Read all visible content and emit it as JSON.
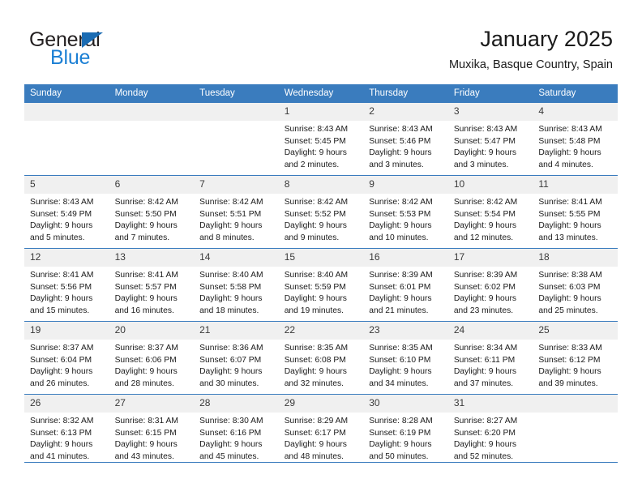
{
  "brand": {
    "logo_text_primary": "General",
    "logo_text_secondary": "Blue",
    "logo_triangle_color": "#1b6cb3",
    "logo_secondary_color": "#1b7fd4"
  },
  "header": {
    "title": "January 2025",
    "subtitle": "Muxika, Basque Country, Spain"
  },
  "theme": {
    "header_row_bg": "#3a7cbe",
    "daynum_bg": "#f0f0f0",
    "grid_line": "#3a7cbe",
    "text": "#1a1a1a"
  },
  "calendar": {
    "weekday_headers": [
      "Sunday",
      "Monday",
      "Tuesday",
      "Wednesday",
      "Thursday",
      "Friday",
      "Saturday"
    ],
    "weeks": [
      [
        {
          "day": "",
          "lines": []
        },
        {
          "day": "",
          "lines": []
        },
        {
          "day": "",
          "lines": []
        },
        {
          "day": "1",
          "lines": [
            "Sunrise: 8:43 AM",
            "Sunset: 5:45 PM",
            "Daylight: 9 hours",
            "and 2 minutes."
          ]
        },
        {
          "day": "2",
          "lines": [
            "Sunrise: 8:43 AM",
            "Sunset: 5:46 PM",
            "Daylight: 9 hours",
            "and 3 minutes."
          ]
        },
        {
          "day": "3",
          "lines": [
            "Sunrise: 8:43 AM",
            "Sunset: 5:47 PM",
            "Daylight: 9 hours",
            "and 3 minutes."
          ]
        },
        {
          "day": "4",
          "lines": [
            "Sunrise: 8:43 AM",
            "Sunset: 5:48 PM",
            "Daylight: 9 hours",
            "and 4 minutes."
          ]
        }
      ],
      [
        {
          "day": "5",
          "lines": [
            "Sunrise: 8:43 AM",
            "Sunset: 5:49 PM",
            "Daylight: 9 hours",
            "and 5 minutes."
          ]
        },
        {
          "day": "6",
          "lines": [
            "Sunrise: 8:42 AM",
            "Sunset: 5:50 PM",
            "Daylight: 9 hours",
            "and 7 minutes."
          ]
        },
        {
          "day": "7",
          "lines": [
            "Sunrise: 8:42 AM",
            "Sunset: 5:51 PM",
            "Daylight: 9 hours",
            "and 8 minutes."
          ]
        },
        {
          "day": "8",
          "lines": [
            "Sunrise: 8:42 AM",
            "Sunset: 5:52 PM",
            "Daylight: 9 hours",
            "and 9 minutes."
          ]
        },
        {
          "day": "9",
          "lines": [
            "Sunrise: 8:42 AM",
            "Sunset: 5:53 PM",
            "Daylight: 9 hours",
            "and 10 minutes."
          ]
        },
        {
          "day": "10",
          "lines": [
            "Sunrise: 8:42 AM",
            "Sunset: 5:54 PM",
            "Daylight: 9 hours",
            "and 12 minutes."
          ]
        },
        {
          "day": "11",
          "lines": [
            "Sunrise: 8:41 AM",
            "Sunset: 5:55 PM",
            "Daylight: 9 hours",
            "and 13 minutes."
          ]
        }
      ],
      [
        {
          "day": "12",
          "lines": [
            "Sunrise: 8:41 AM",
            "Sunset: 5:56 PM",
            "Daylight: 9 hours",
            "and 15 minutes."
          ]
        },
        {
          "day": "13",
          "lines": [
            "Sunrise: 8:41 AM",
            "Sunset: 5:57 PM",
            "Daylight: 9 hours",
            "and 16 minutes."
          ]
        },
        {
          "day": "14",
          "lines": [
            "Sunrise: 8:40 AM",
            "Sunset: 5:58 PM",
            "Daylight: 9 hours",
            "and 18 minutes."
          ]
        },
        {
          "day": "15",
          "lines": [
            "Sunrise: 8:40 AM",
            "Sunset: 5:59 PM",
            "Daylight: 9 hours",
            "and 19 minutes."
          ]
        },
        {
          "day": "16",
          "lines": [
            "Sunrise: 8:39 AM",
            "Sunset: 6:01 PM",
            "Daylight: 9 hours",
            "and 21 minutes."
          ]
        },
        {
          "day": "17",
          "lines": [
            "Sunrise: 8:39 AM",
            "Sunset: 6:02 PM",
            "Daylight: 9 hours",
            "and 23 minutes."
          ]
        },
        {
          "day": "18",
          "lines": [
            "Sunrise: 8:38 AM",
            "Sunset: 6:03 PM",
            "Daylight: 9 hours",
            "and 25 minutes."
          ]
        }
      ],
      [
        {
          "day": "19",
          "lines": [
            "Sunrise: 8:37 AM",
            "Sunset: 6:04 PM",
            "Daylight: 9 hours",
            "and 26 minutes."
          ]
        },
        {
          "day": "20",
          "lines": [
            "Sunrise: 8:37 AM",
            "Sunset: 6:06 PM",
            "Daylight: 9 hours",
            "and 28 minutes."
          ]
        },
        {
          "day": "21",
          "lines": [
            "Sunrise: 8:36 AM",
            "Sunset: 6:07 PM",
            "Daylight: 9 hours",
            "and 30 minutes."
          ]
        },
        {
          "day": "22",
          "lines": [
            "Sunrise: 8:35 AM",
            "Sunset: 6:08 PM",
            "Daylight: 9 hours",
            "and 32 minutes."
          ]
        },
        {
          "day": "23",
          "lines": [
            "Sunrise: 8:35 AM",
            "Sunset: 6:10 PM",
            "Daylight: 9 hours",
            "and 34 minutes."
          ]
        },
        {
          "day": "24",
          "lines": [
            "Sunrise: 8:34 AM",
            "Sunset: 6:11 PM",
            "Daylight: 9 hours",
            "and 37 minutes."
          ]
        },
        {
          "day": "25",
          "lines": [
            "Sunrise: 8:33 AM",
            "Sunset: 6:12 PM",
            "Daylight: 9 hours",
            "and 39 minutes."
          ]
        }
      ],
      [
        {
          "day": "26",
          "lines": [
            "Sunrise: 8:32 AM",
            "Sunset: 6:13 PM",
            "Daylight: 9 hours",
            "and 41 minutes."
          ]
        },
        {
          "day": "27",
          "lines": [
            "Sunrise: 8:31 AM",
            "Sunset: 6:15 PM",
            "Daylight: 9 hours",
            "and 43 minutes."
          ]
        },
        {
          "day": "28",
          "lines": [
            "Sunrise: 8:30 AM",
            "Sunset: 6:16 PM",
            "Daylight: 9 hours",
            "and 45 minutes."
          ]
        },
        {
          "day": "29",
          "lines": [
            "Sunrise: 8:29 AM",
            "Sunset: 6:17 PM",
            "Daylight: 9 hours",
            "and 48 minutes."
          ]
        },
        {
          "day": "30",
          "lines": [
            "Sunrise: 8:28 AM",
            "Sunset: 6:19 PM",
            "Daylight: 9 hours",
            "and 50 minutes."
          ]
        },
        {
          "day": "31",
          "lines": [
            "Sunrise: 8:27 AM",
            "Sunset: 6:20 PM",
            "Daylight: 9 hours",
            "and 52 minutes."
          ]
        },
        {
          "day": "",
          "lines": []
        }
      ]
    ]
  }
}
